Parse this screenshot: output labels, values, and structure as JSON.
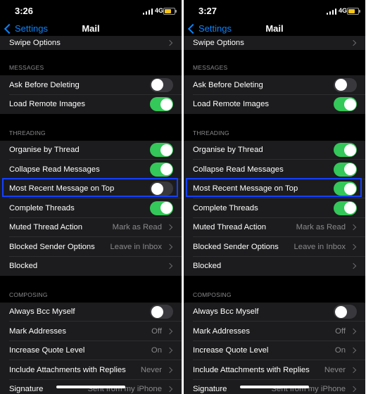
{
  "panels": [
    {
      "time": "3:26",
      "network": "4G",
      "back_label": "Settings",
      "title": "Mail",
      "top_row": "Swipe Options",
      "sections": [
        {
          "header": "MESSAGES",
          "rows": [
            {
              "label": "Ask Before Deleting",
              "type": "toggle",
              "on": false
            },
            {
              "label": "Load Remote Images",
              "type": "toggle",
              "on": true
            }
          ]
        },
        {
          "header": "THREADING",
          "rows": [
            {
              "label": "Organise by Thread",
              "type": "toggle",
              "on": true
            },
            {
              "label": "Collapse Read Messages",
              "type": "toggle",
              "on": true
            },
            {
              "label": "Most Recent Message on Top",
              "type": "toggle",
              "on": false
            },
            {
              "label": "Complete Threads",
              "type": "toggle",
              "on": true
            },
            {
              "label": "Muted Thread Action",
              "type": "nav",
              "value": "Mark as Read"
            },
            {
              "label": "Blocked Sender Options",
              "type": "nav",
              "value": "Leave in Inbox"
            },
            {
              "label": "Blocked",
              "type": "nav",
              "value": ""
            }
          ]
        },
        {
          "header": "COMPOSING",
          "rows": [
            {
              "label": "Always Bcc Myself",
              "type": "toggle",
              "on": false
            },
            {
              "label": "Mark Addresses",
              "type": "nav",
              "value": "Off"
            },
            {
              "label": "Increase Quote Level",
              "type": "nav",
              "value": "On"
            },
            {
              "label": "Include Attachments with Replies",
              "type": "nav",
              "value": "Never"
            },
            {
              "label": "Signature",
              "type": "nav",
              "value": "Sent from my iPhone"
            }
          ]
        }
      ]
    },
    {
      "time": "3:27",
      "network": "4G",
      "back_label": "Settings",
      "title": "Mail",
      "top_row": "Swipe Options",
      "sections": [
        {
          "header": "MESSAGES",
          "rows": [
            {
              "label": "Ask Before Deleting",
              "type": "toggle",
              "on": false
            },
            {
              "label": "Load Remote Images",
              "type": "toggle",
              "on": true
            }
          ]
        },
        {
          "header": "THREADING",
          "rows": [
            {
              "label": "Organise by Thread",
              "type": "toggle",
              "on": true
            },
            {
              "label": "Collapse Read Messages",
              "type": "toggle",
              "on": true
            },
            {
              "label": "Most Recent Message on Top",
              "type": "toggle",
              "on": true
            },
            {
              "label": "Complete Threads",
              "type": "toggle",
              "on": true
            },
            {
              "label": "Muted Thread Action",
              "type": "nav",
              "value": "Mark as Read"
            },
            {
              "label": "Blocked Sender Options",
              "type": "nav",
              "value": "Leave in Inbox"
            },
            {
              "label": "Blocked",
              "type": "nav",
              "value": ""
            }
          ]
        },
        {
          "header": "COMPOSING",
          "rows": [
            {
              "label": "Always Bcc Myself",
              "type": "toggle",
              "on": false
            },
            {
              "label": "Mark Addresses",
              "type": "nav",
              "value": "Off"
            },
            {
              "label": "Increase Quote Level",
              "type": "nav",
              "value": "On"
            },
            {
              "label": "Include Attachments with Replies",
              "type": "nav",
              "value": "Never"
            },
            {
              "label": "Signature",
              "type": "nav",
              "value": "Sent from my iPhone"
            }
          ]
        }
      ]
    }
  ],
  "colors": {
    "accent": "#0a84ff",
    "toggle_on": "#34c759",
    "toggle_off": "#39393d",
    "highlight_box": "#1440ff"
  }
}
